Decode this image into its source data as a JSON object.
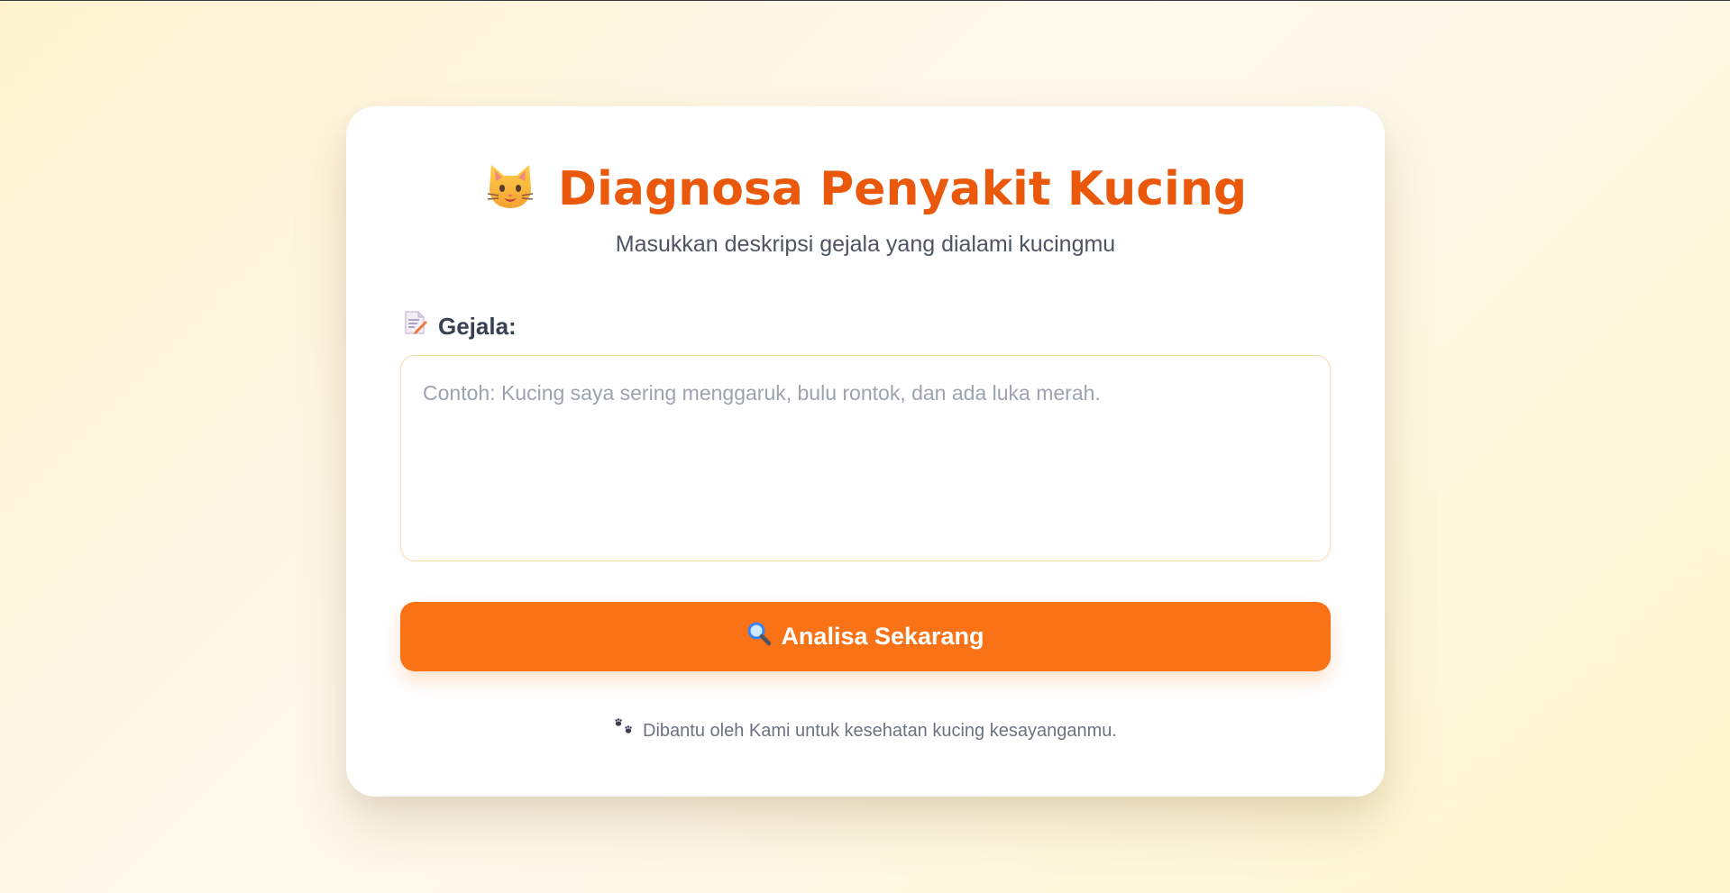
{
  "header": {
    "title_icon": "cat-face-icon",
    "title": "Diagnosa Penyakit Kucing",
    "subtitle": "Masukkan deskripsi gejala yang dialami kucingmu"
  },
  "form": {
    "label_icon": "memo-icon",
    "symptom_label": "Gejala:",
    "symptom_value": "",
    "symptom_placeholder": "Contoh: Kucing saya sering menggaruk, bulu rontok, dan ada luka merah.",
    "submit_icon": "magnifier-icon",
    "submit_label": "Analisa Sekarang"
  },
  "footer": {
    "icon": "paw-prints-icon",
    "text": "Dibantu oleh Kami untuk kesehatan kucing kesayanganmu."
  },
  "colors": {
    "accent": "#ea580c",
    "button": "#f97316",
    "input_border": "#fcd9a8",
    "placeholder": "#9ca3af"
  }
}
